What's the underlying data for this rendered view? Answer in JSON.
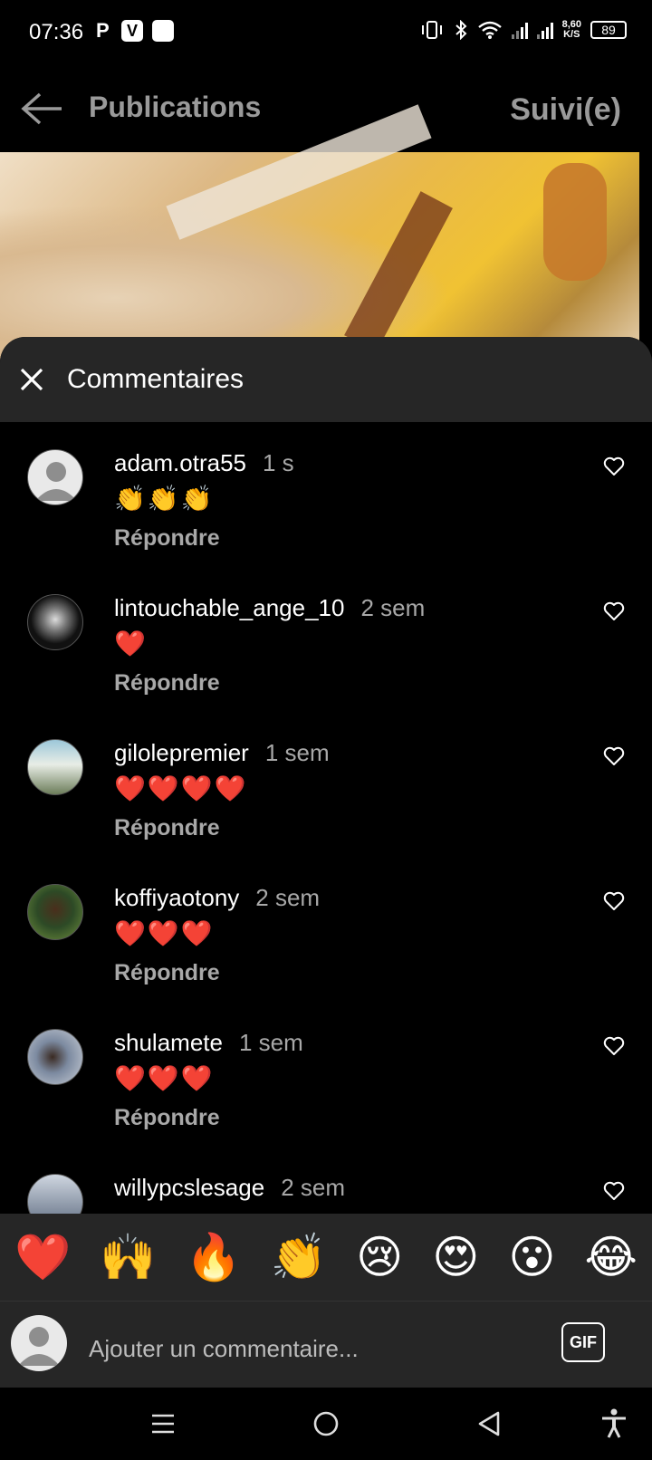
{
  "status_bar": {
    "time": "07:36",
    "left_icons": [
      "P",
      "V",
      "white-square-icon"
    ],
    "speed": "8,60",
    "speed_unit": "K/S",
    "battery": "89"
  },
  "header": {
    "title": "Publications",
    "follow_label": "Suivi(e)"
  },
  "comments_sheet": {
    "title": "Commentaires",
    "comments": [
      {
        "username": "adam.otra55",
        "time": "1 s",
        "text": "👏👏👏",
        "reply": "Répondre"
      },
      {
        "username": "lintouchable_ange_10",
        "time": "2 sem",
        "text": "❤️",
        "reply": "Répondre"
      },
      {
        "username": "gilolepremier",
        "time": "1 sem",
        "text": "❤️❤️❤️❤️",
        "reply": "Répondre"
      },
      {
        "username": "koffiyaotony",
        "time": "2 sem",
        "text": "❤️❤️❤️",
        "reply": "Répondre"
      },
      {
        "username": "shulamete",
        "time": "1 sem",
        "text": "❤️❤️❤️",
        "reply": "Répondre"
      },
      {
        "username": "willypcslesage",
        "time": "2 sem",
        "text": "",
        "reply": ""
      }
    ]
  },
  "emoji_bar": [
    "❤️",
    "🙌",
    "🔥",
    "👏",
    "😢",
    "😍",
    "😮",
    "😂"
  ],
  "comment_input": {
    "placeholder": "Ajouter un commentaire...",
    "gif_label": "GIF"
  },
  "colors": {
    "sheet_header": "#262626",
    "secondary_text": "#a8a8a8",
    "background": "#000000"
  }
}
